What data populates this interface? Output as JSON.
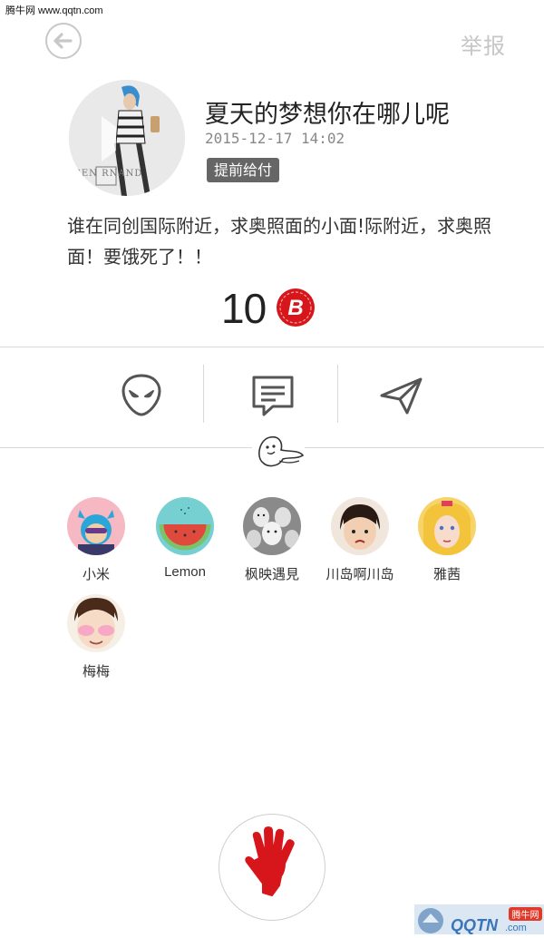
{
  "site_watermark": "腾牛网 www.qqtn.com",
  "header": {
    "back_icon": "back-arrow-icon",
    "report_label": "举报"
  },
  "post": {
    "title": "夏天的梦想你在哪儿呢",
    "time": "2015-12-17  14:02",
    "tag": "提前给付",
    "content": "谁在同创国际附近，求奥照面的小面!际附近，求奥照面！要饿死了！！",
    "amount": "10",
    "currency_badge": "B"
  },
  "actions": [
    {
      "icon": "alien-face-icon"
    },
    {
      "icon": "comment-icon"
    },
    {
      "icon": "send-icon"
    }
  ],
  "users": [
    {
      "name": "小米"
    },
    {
      "name": "Lemon"
    },
    {
      "name": "枫映遇見"
    },
    {
      "name": "川岛啊川岛"
    },
    {
      "name": "雅茜"
    },
    {
      "name": "梅梅"
    }
  ],
  "bottom_button": {
    "icon": "hand-icon"
  },
  "corner_watermark": {
    "brand": "QQTN",
    "suffix": ".com",
    "badge": "腾牛网"
  },
  "colors": {
    "accent_red": "#d7161b",
    "divider": "#d8d8d8",
    "muted": "#c6c6c6"
  }
}
